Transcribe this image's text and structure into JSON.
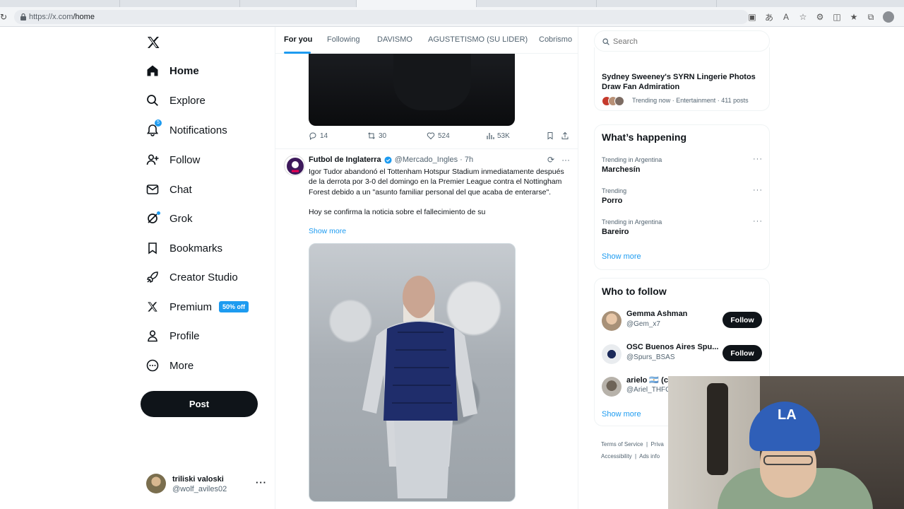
{
  "browser": {
    "url_host": "https://x.com",
    "url_path": "/home"
  },
  "nav": {
    "items": [
      {
        "label": "Home",
        "icon": "home-icon",
        "active": true
      },
      {
        "label": "Explore",
        "icon": "search-icon"
      },
      {
        "label": "Notifications",
        "icon": "bell-icon",
        "badge": "5"
      },
      {
        "label": "Follow",
        "icon": "add-person-icon"
      },
      {
        "label": "Chat",
        "icon": "mail-icon"
      },
      {
        "label": "Grok",
        "icon": "grok-icon"
      },
      {
        "label": "Bookmarks",
        "icon": "bookmark-icon"
      },
      {
        "label": "Creator Studio",
        "icon": "rocket-icon"
      },
      {
        "label": "Premium",
        "icon": "x-logo-icon",
        "badge": "50% off"
      },
      {
        "label": "Profile",
        "icon": "person-icon"
      },
      {
        "label": "More",
        "icon": "more-circle-icon"
      }
    ],
    "post_label": "Post",
    "account": {
      "name": "triliski valoski",
      "handle": "@wolf_aviles02"
    }
  },
  "timeline": {
    "tabs": [
      "For you",
      "Following",
      "DAVISMO",
      "AGUSTETISMO (SU LIDER)",
      "Cobrismo"
    ],
    "prev_post_stats": {
      "replies": "14",
      "reposts": "30",
      "likes": "524",
      "views": "53K"
    },
    "tweet": {
      "author": "Futbol de Inglaterra",
      "handle": "@Mercado_Ingles",
      "time": "7h",
      "text": "Igor Tudor abandonó el Tottenham Hotspur Stadium inmediatamente después de la derrota por 3-0 del domingo en la Premier League contra el Nottingham Forest debido a un \"asunto familiar personal del que acaba de enterarse\".\n\nHoy se confirma la noticia sobre el fallecimiento de su",
      "show_more": "Show more"
    }
  },
  "sidebar": {
    "search_placeholder": "Search",
    "top_trend": {
      "headline": "Sydney Sweeney's SYRN Lingerie Photos Draw Fan Admiration",
      "meta": "Trending now · Entertainment · 411 posts"
    },
    "happening": {
      "title": "What’s happening",
      "trends": [
        {
          "context": "Trending in Argentina",
          "name": "Marchesín"
        },
        {
          "context": "Trending",
          "name": "Porro"
        },
        {
          "context": "Trending in Argentina",
          "name": "Bareiro"
        }
      ],
      "show_more": "Show more"
    },
    "who_to_follow": {
      "title": "Who to follow",
      "accounts": [
        {
          "name": "Gemma Ashman",
          "handle": "@Gem_x7"
        },
        {
          "name": "OSC Buenos Aires Spu...",
          "handle": "@Spurs_BSAS"
        },
        {
          "name": "arielo 🇦🇷 (c",
          "handle": "@Ariel_THFC"
        }
      ],
      "follow_label": "Follow",
      "show_more": "Show more"
    },
    "footer": [
      "Terms of Service",
      "Priva",
      "Accessibility",
      "Ads info"
    ]
  },
  "colors": {
    "accent": "#1d9bf0",
    "text": "#0f1419",
    "muted": "#536471"
  }
}
